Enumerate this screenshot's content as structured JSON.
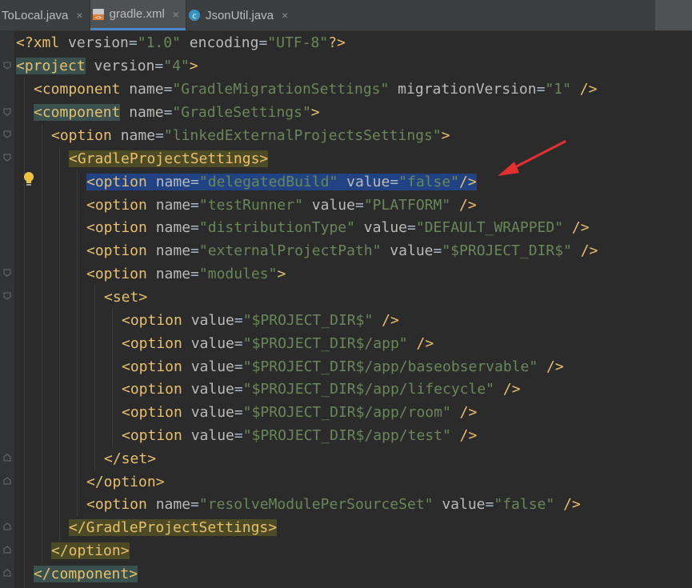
{
  "tabs": [
    {
      "label": "ToLocal.java",
      "icon": "java-class-icon",
      "active": false
    },
    {
      "label": "gradle.xml",
      "icon": "xml-file-icon",
      "active": true
    },
    {
      "label": "JsonUtil.java",
      "icon": "java-class-icon",
      "active": false
    }
  ],
  "close_glyph": "×",
  "code": {
    "l1": {
      "a": "<?",
      "b": "xml",
      "c": " version",
      "d": "=",
      "e": "\"1.0\"",
      "f": " encoding",
      "g": "=",
      "h": "\"UTF-8\"",
      "i": "?>"
    },
    "l2": {
      "a": "<project",
      "b": " version",
      "c": "=",
      "d": "\"4\"",
      "e": ">"
    },
    "l3": {
      "a": "<component",
      "b": " name",
      "c": "=",
      "d": "\"GradleMigrationSettings\"",
      "e": " migrationVersion",
      "f": "=",
      "g": "\"1\"",
      "h": " />"
    },
    "l4": {
      "a": "<component",
      "b": " name",
      "c": "=",
      "d": "\"GradleSettings\"",
      "e": ">"
    },
    "l5": {
      "a": "<option",
      "b": " name",
      "c": "=",
      "d": "\"linkedExternalProjectsSettings\"",
      "e": ">"
    },
    "l6": {
      "a": "<GradleProjectSettings",
      "b": ">"
    },
    "l7": {
      "a": "<option",
      "b": " name",
      "c": "=",
      "d": "\"delegatedBuild\"",
      "e": " value",
      "f": "=",
      "g": "\"false\"",
      "h": "/>"
    },
    "l8": {
      "a": "<option",
      "b": " name",
      "c": "=",
      "d": "\"testRunner\"",
      "e": " value",
      "f": "=",
      "g": "\"PLATFORM\"",
      "h": " />"
    },
    "l9": {
      "a": "<option",
      "b": " name",
      "c": "=",
      "d": "\"distributionType\"",
      "e": " value",
      "f": "=",
      "g": "\"DEFAULT_WRAPPED\"",
      "h": " />"
    },
    "l10": {
      "a": "<option",
      "b": " name",
      "c": "=",
      "d": "\"externalProjectPath\"",
      "e": " value",
      "f": "=",
      "g": "\"$PROJECT_DIR$\"",
      "h": " />"
    },
    "l11": {
      "a": "<option",
      "b": " name",
      "c": "=",
      "d": "\"modules\"",
      "e": ">"
    },
    "l12": {
      "a": "<set",
      "b": ">"
    },
    "l13": {
      "a": "<option",
      "b": " value",
      "c": "=",
      "d": "\"$PROJECT_DIR$\"",
      "e": " />"
    },
    "l14": {
      "a": "<option",
      "b": " value",
      "c": "=",
      "d": "\"$PROJECT_DIR$/app\"",
      "e": " />"
    },
    "l15": {
      "a": "<option",
      "b": " value",
      "c": "=",
      "d": "\"$PROJECT_DIR$/app/baseobservable\"",
      "e": " />"
    },
    "l16": {
      "a": "<option",
      "b": " value",
      "c": "=",
      "d": "\"$PROJECT_DIR$/app/lifecycle\"",
      "e": " />"
    },
    "l17": {
      "a": "<option",
      "b": " value",
      "c": "=",
      "d": "\"$PROJECT_DIR$/app/room\"",
      "e": " />"
    },
    "l18": {
      "a": "<option",
      "b": " value",
      "c": "=",
      "d": "\"$PROJECT_DIR$/app/test\"",
      "e": " />"
    },
    "l19": {
      "a": "</set",
      "b": ">"
    },
    "l20": {
      "a": "</option",
      "b": ">"
    },
    "l21": {
      "a": "<option",
      "b": " name",
      "c": "=",
      "d": "\"resolveModulePerSourceSet\"",
      "e": " value",
      "f": "=",
      "g": "\"false\"",
      "h": " />"
    },
    "l22": {
      "a": "</GradleProjectSettings",
      "b": ">"
    },
    "l23": {
      "a": "</option",
      "b": ">"
    },
    "l24": {
      "a": "</component",
      "b": ">"
    }
  },
  "colors": {
    "background": "#2b2b2b",
    "tag": "#e8bf6a",
    "attribute": "#bababa",
    "string": "#6a8759",
    "selection": "#214283",
    "annotation_arrow": "#e03030"
  }
}
